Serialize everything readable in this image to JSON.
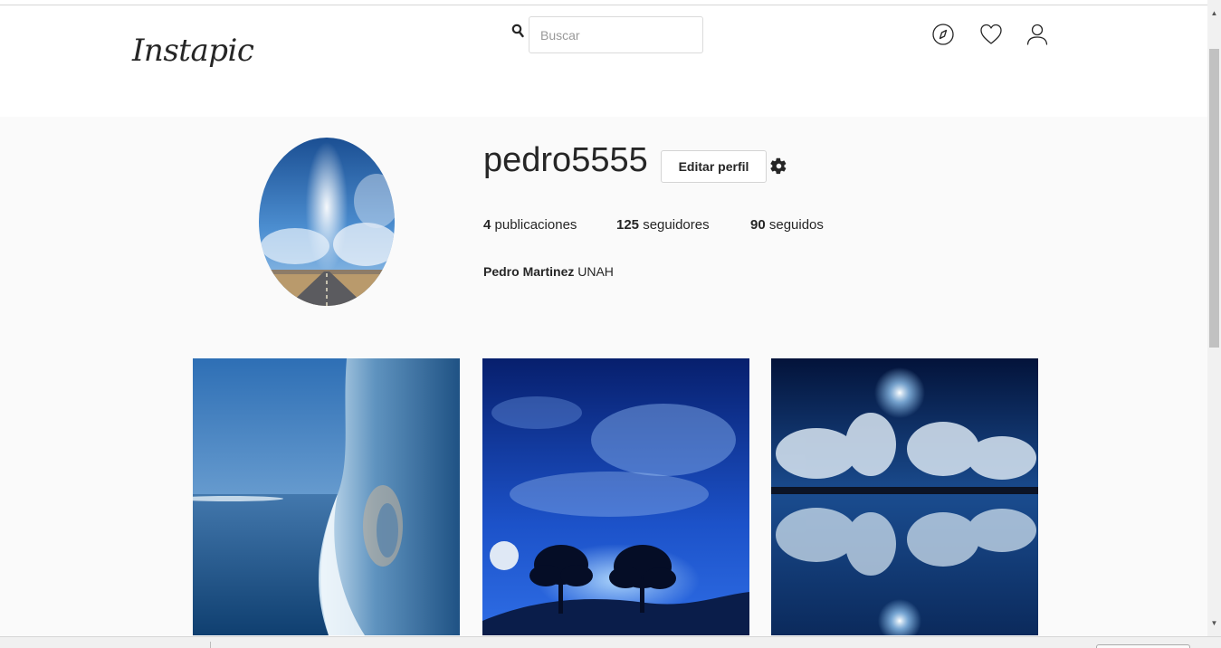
{
  "header": {
    "logo": "Instapic",
    "search_placeholder": "Buscar",
    "icons": [
      "search-icon",
      "compass-icon",
      "heart-icon",
      "user-icon"
    ]
  },
  "profile": {
    "username": "pedro5555",
    "edit_button": "Editar perfil",
    "stats": {
      "posts_count": "4",
      "posts_label": "publicaciones",
      "followers_count": "125",
      "followers_label": "seguidores",
      "following_count": "90",
      "following_label": "seguidos"
    },
    "full_name": "Pedro Martinez",
    "bio": "UNAH"
  },
  "posts": [
    {
      "name": "photo-wave"
    },
    {
      "name": "photo-night-trees"
    },
    {
      "name": "photo-sky-reflection"
    }
  ],
  "colors": {
    "text": "#262626",
    "border": "#dbdbdb",
    "page_background": "#fafafa",
    "header_background": "#ffffff"
  }
}
